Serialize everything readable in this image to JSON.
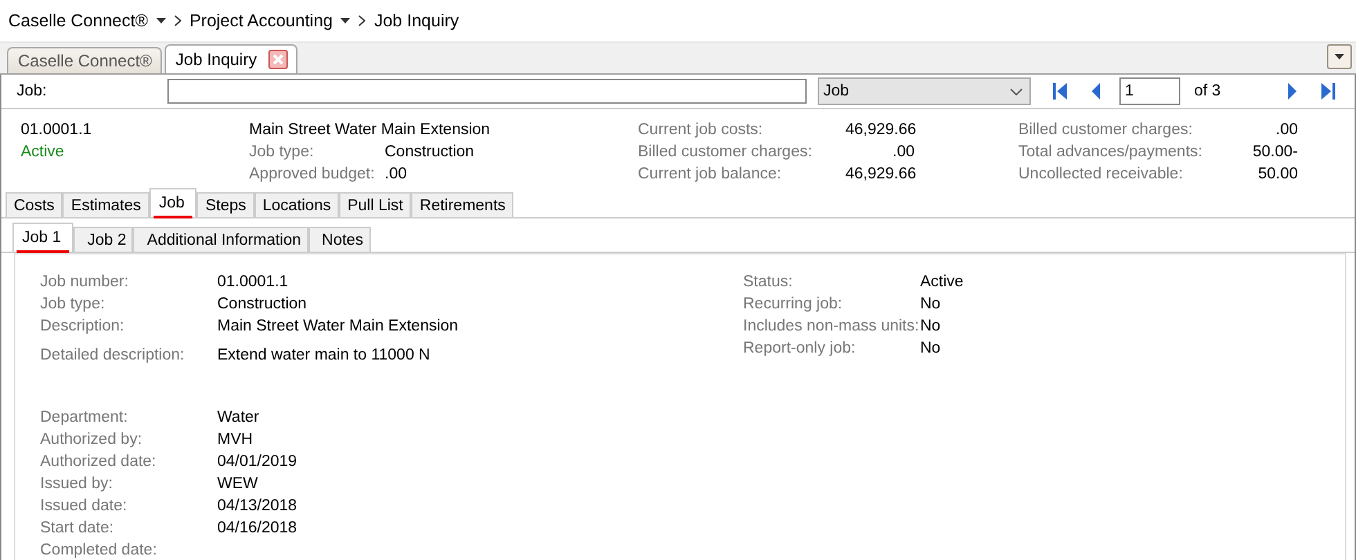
{
  "breadcrumb": [
    {
      "label": "Caselle Connect®",
      "has_menu": true
    },
    {
      "label": "Project Accounting",
      "has_menu": true
    },
    {
      "label": "Job Inquiry",
      "has_menu": false
    }
  ],
  "doc_tabs": [
    {
      "label": "Caselle Connect®",
      "selected": false,
      "closable": false
    },
    {
      "label": "Job Inquiry",
      "selected": true,
      "closable": true
    }
  ],
  "lookup": {
    "label": "Job:",
    "search_by": "Job",
    "page": "1",
    "page_count": "of 3"
  },
  "summary": {
    "job_number": "01.0001.1",
    "status": "Active",
    "description": "Main Street Water Main Extension",
    "middle": [
      {
        "label": "Job type:",
        "value": "Construction"
      },
      {
        "label": "Approved budget:",
        "value": ".00"
      }
    ],
    "costs": [
      {
        "label": "Current job costs:",
        "value": "46,929.66"
      },
      {
        "label": "Billed customer charges:",
        "value": ".00"
      },
      {
        "label": "Current job balance:",
        "value": "46,929.66"
      }
    ],
    "billing": [
      {
        "label": "Billed customer charges:",
        "value": ".00"
      },
      {
        "label": "Total advances/payments:",
        "value": "50.00-"
      },
      {
        "label": "Uncollected receivable:",
        "value": "50.00"
      }
    ]
  },
  "tabs": [
    {
      "label": "Costs",
      "selected": false
    },
    {
      "label": "Estimates",
      "selected": false
    },
    {
      "label": "Job",
      "selected": true
    },
    {
      "label": "Steps",
      "selected": false
    },
    {
      "label": "Locations",
      "selected": false
    },
    {
      "label": "Pull List",
      "selected": false
    },
    {
      "label": "Retirements",
      "selected": false
    }
  ],
  "subtabs": [
    {
      "label": "Job 1",
      "selected": true
    },
    {
      "label": "Job 2",
      "selected": false
    },
    {
      "label": "Additional Information",
      "selected": false
    },
    {
      "label": "Notes",
      "selected": false
    }
  ],
  "details": {
    "left": [
      {
        "label": "Job number:",
        "value": "01.0001.1"
      },
      {
        "label": "Job type:",
        "value": "Construction"
      },
      {
        "label": "Description:",
        "value": "Main Street Water Main Extension"
      },
      {
        "label": "Detailed description:",
        "value": "Extend water main to 11000 N"
      }
    ],
    "right": [
      {
        "label": "Status:",
        "value": "Active"
      },
      {
        "label": "Recurring job:",
        "value": "No"
      },
      {
        "label": "Includes non-mass units:",
        "value": "No"
      },
      {
        "label": "Report-only job:",
        "value": "No"
      }
    ],
    "lower": [
      {
        "label": "Department:",
        "value": "Water"
      },
      {
        "label": "Authorized by:",
        "value": "MVH"
      },
      {
        "label": "Authorized date:",
        "value": "04/01/2019"
      },
      {
        "label": "Issued by:",
        "value": "WEW"
      },
      {
        "label": "Issued date:",
        "value": "04/13/2018"
      },
      {
        "label": "Start date:",
        "value": "04/16/2018"
      },
      {
        "label": "Completed date:"
      }
    ]
  }
}
